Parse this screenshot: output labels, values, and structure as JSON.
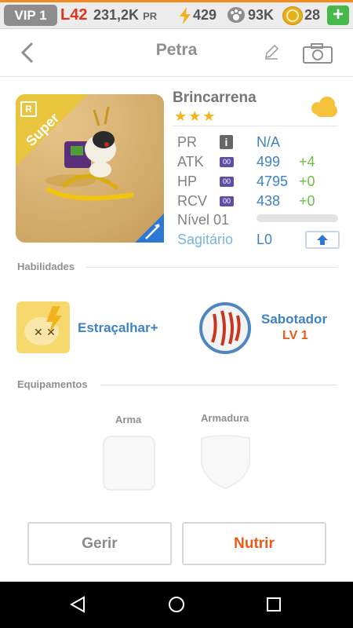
{
  "status_bar": {
    "vip": "VIP 1",
    "level": "L42",
    "pr_value": "231,2K",
    "pr_unit": "PR",
    "energy": "429",
    "paw_points": "93K",
    "coins": "28",
    "add": "+",
    "icons": [
      "bolt-icon",
      "paw-icon",
      "coin-icon",
      "plus-icon"
    ]
  },
  "header": {
    "title": "Petra",
    "icons": [
      "back-icon",
      "pencil-icon",
      "camera-icon"
    ]
  },
  "pet": {
    "name": "Brincarrena",
    "stars": "★★★",
    "rarity_badge": "R",
    "tag": "Super",
    "element_icon": "cloud-icon"
  },
  "stats": [
    {
      "label": "PR",
      "value": "N/A",
      "bonus": ""
    },
    {
      "label": "ATK",
      "value": "499",
      "bonus": "+4"
    },
    {
      "label": "HP",
      "value": "4795",
      "bonus": "+0"
    },
    {
      "label": "RCV",
      "value": "438",
      "bonus": "+0"
    }
  ],
  "level_label": "Nível 01",
  "sign": "Sagitário",
  "sign_level": "L0",
  "sections": {
    "skills": "Habilidades",
    "equipment": "Equipamentos"
  },
  "skills": [
    {
      "name": "Estraçalhar+"
    },
    {
      "name": "Sabotador",
      "level": "LV 1"
    }
  ],
  "equipment": {
    "weapon": "Arma",
    "armor": "Armadura"
  },
  "buttons": {
    "manage": "Gerir",
    "feed": "Nutrir"
  },
  "colors": {
    "accent_blue": "#3f82c2",
    "accent_orange": "#ea5a16",
    "bonus_green": "#6bc147",
    "star": "#f5b51b"
  }
}
